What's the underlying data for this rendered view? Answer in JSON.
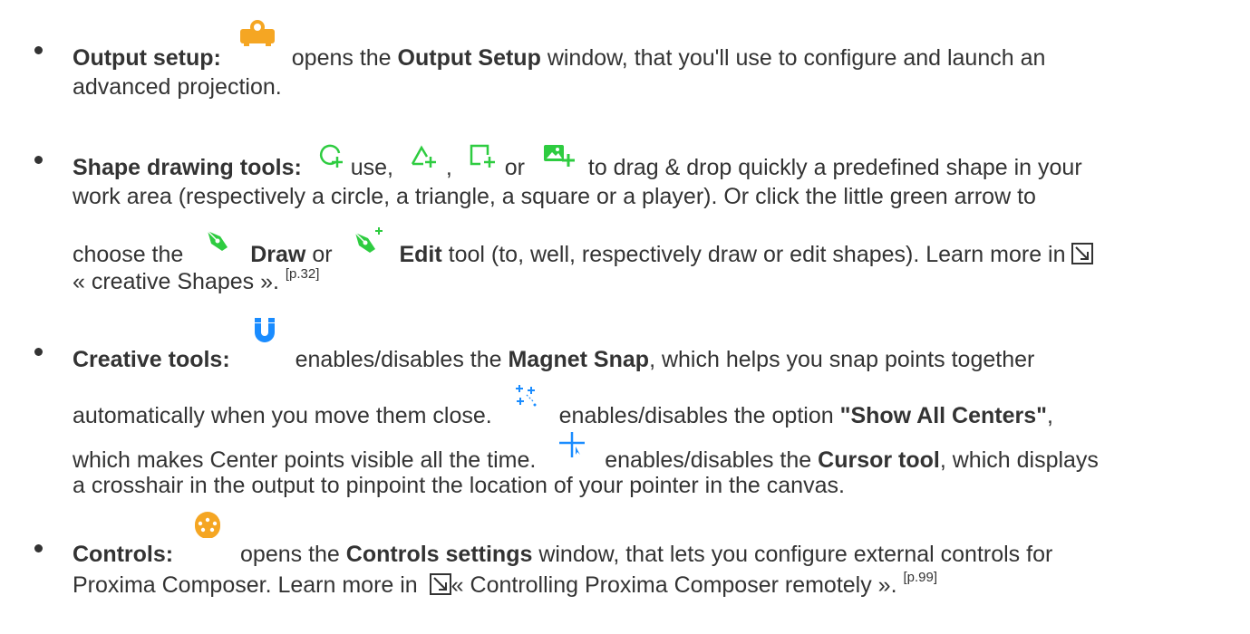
{
  "colors": {
    "text": "#333333",
    "accent_orange": "#f5a623",
    "accent_green": "#2ecc40",
    "accent_blue": "#1a8cff"
  },
  "output_setup": {
    "label": "Output setup:",
    "icon": "projector-icon",
    "t1": "opens the",
    "bold1": "Output Setup",
    "t2": "window, that you'll use to configure and launch an",
    "t3": "advanced projection."
  },
  "shape_tools": {
    "label": "Shape drawing tools:",
    "icons": [
      "circle-add-icon",
      "triangle-add-icon",
      "square-add-icon",
      "player-add-icon"
    ],
    "t_use": "use,",
    "t_comma": ",",
    "t_or": "or",
    "t1": "to drag & drop quickly a predefined shape in your",
    "t2": "work area (respectively a circle, a triangle, a square or a player). Or click the little green arrow to",
    "t3": "choose the",
    "bold_draw": "Draw",
    "t_or2": "or",
    "bold_edit": "Edit",
    "t4": "tool (to, well, respectively draw or edit shapes). Learn more in",
    "link": "« creative Shapes ».",
    "ref": "[p.32]"
  },
  "creative_tools": {
    "label": "Creative tools:",
    "icons": [
      "magnet-icon",
      "show-centers-icon",
      "cursor-crosshair-icon"
    ],
    "t1": "enables/disables the",
    "bold1": "Magnet Snap",
    "t2": ", which helps you snap points together",
    "t3": "automatically when you move them close.",
    "t4": "enables/disables the option",
    "bold2": "\"Show All Centers\"",
    "t5": ",",
    "t6": "which makes Center points visible all the time.",
    "t7": "enables/disables the",
    "bold3": "Cursor tool",
    "t8": ", which displays",
    "t9": "a crosshair in the output to pinpoint the location of your pointer in the canvas."
  },
  "controls": {
    "label": "Controls:",
    "icon": "dmx-controls-icon",
    "t1": "opens the",
    "bold1": "Controls settings",
    "t2": "window, that lets you configure external controls for",
    "t3": "Proxima Composer. Learn more in",
    "link": "« Controlling Proxima Composer remotely ».",
    "ref": "[p.99]"
  }
}
